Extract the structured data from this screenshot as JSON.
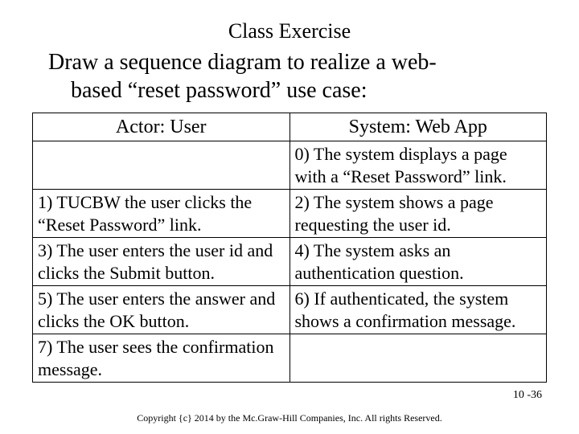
{
  "title": "Class Exercise",
  "subtitle_line1": "Draw a sequence diagram to realize a web-",
  "subtitle_line2": "based “reset password” use case:",
  "table": {
    "header_left": "Actor: User",
    "header_right": "System: Web App",
    "rows": [
      {
        "left": "",
        "right": "0) The system displays a page with  a “Reset Password” link."
      },
      {
        "left": "1) TUCBW the user clicks the “Reset Password” link.",
        "right": "2) The system shows a page requesting the user id."
      },
      {
        "left": "3) The user enters the user id and clicks the Submit button.",
        "right": "4) The system asks an authentication question."
      },
      {
        "left": "5) The user enters the answer and clicks the OK button.",
        "right": "6) If authenticated, the system shows a confirmation message."
      },
      {
        "left": "7) The user sees the confirmation message.",
        "right": ""
      }
    ]
  },
  "page_number": "10 -36",
  "copyright": "Copyright {c} 2014 by the Mc.Graw-Hill Companies, Inc. All rights Reserved."
}
